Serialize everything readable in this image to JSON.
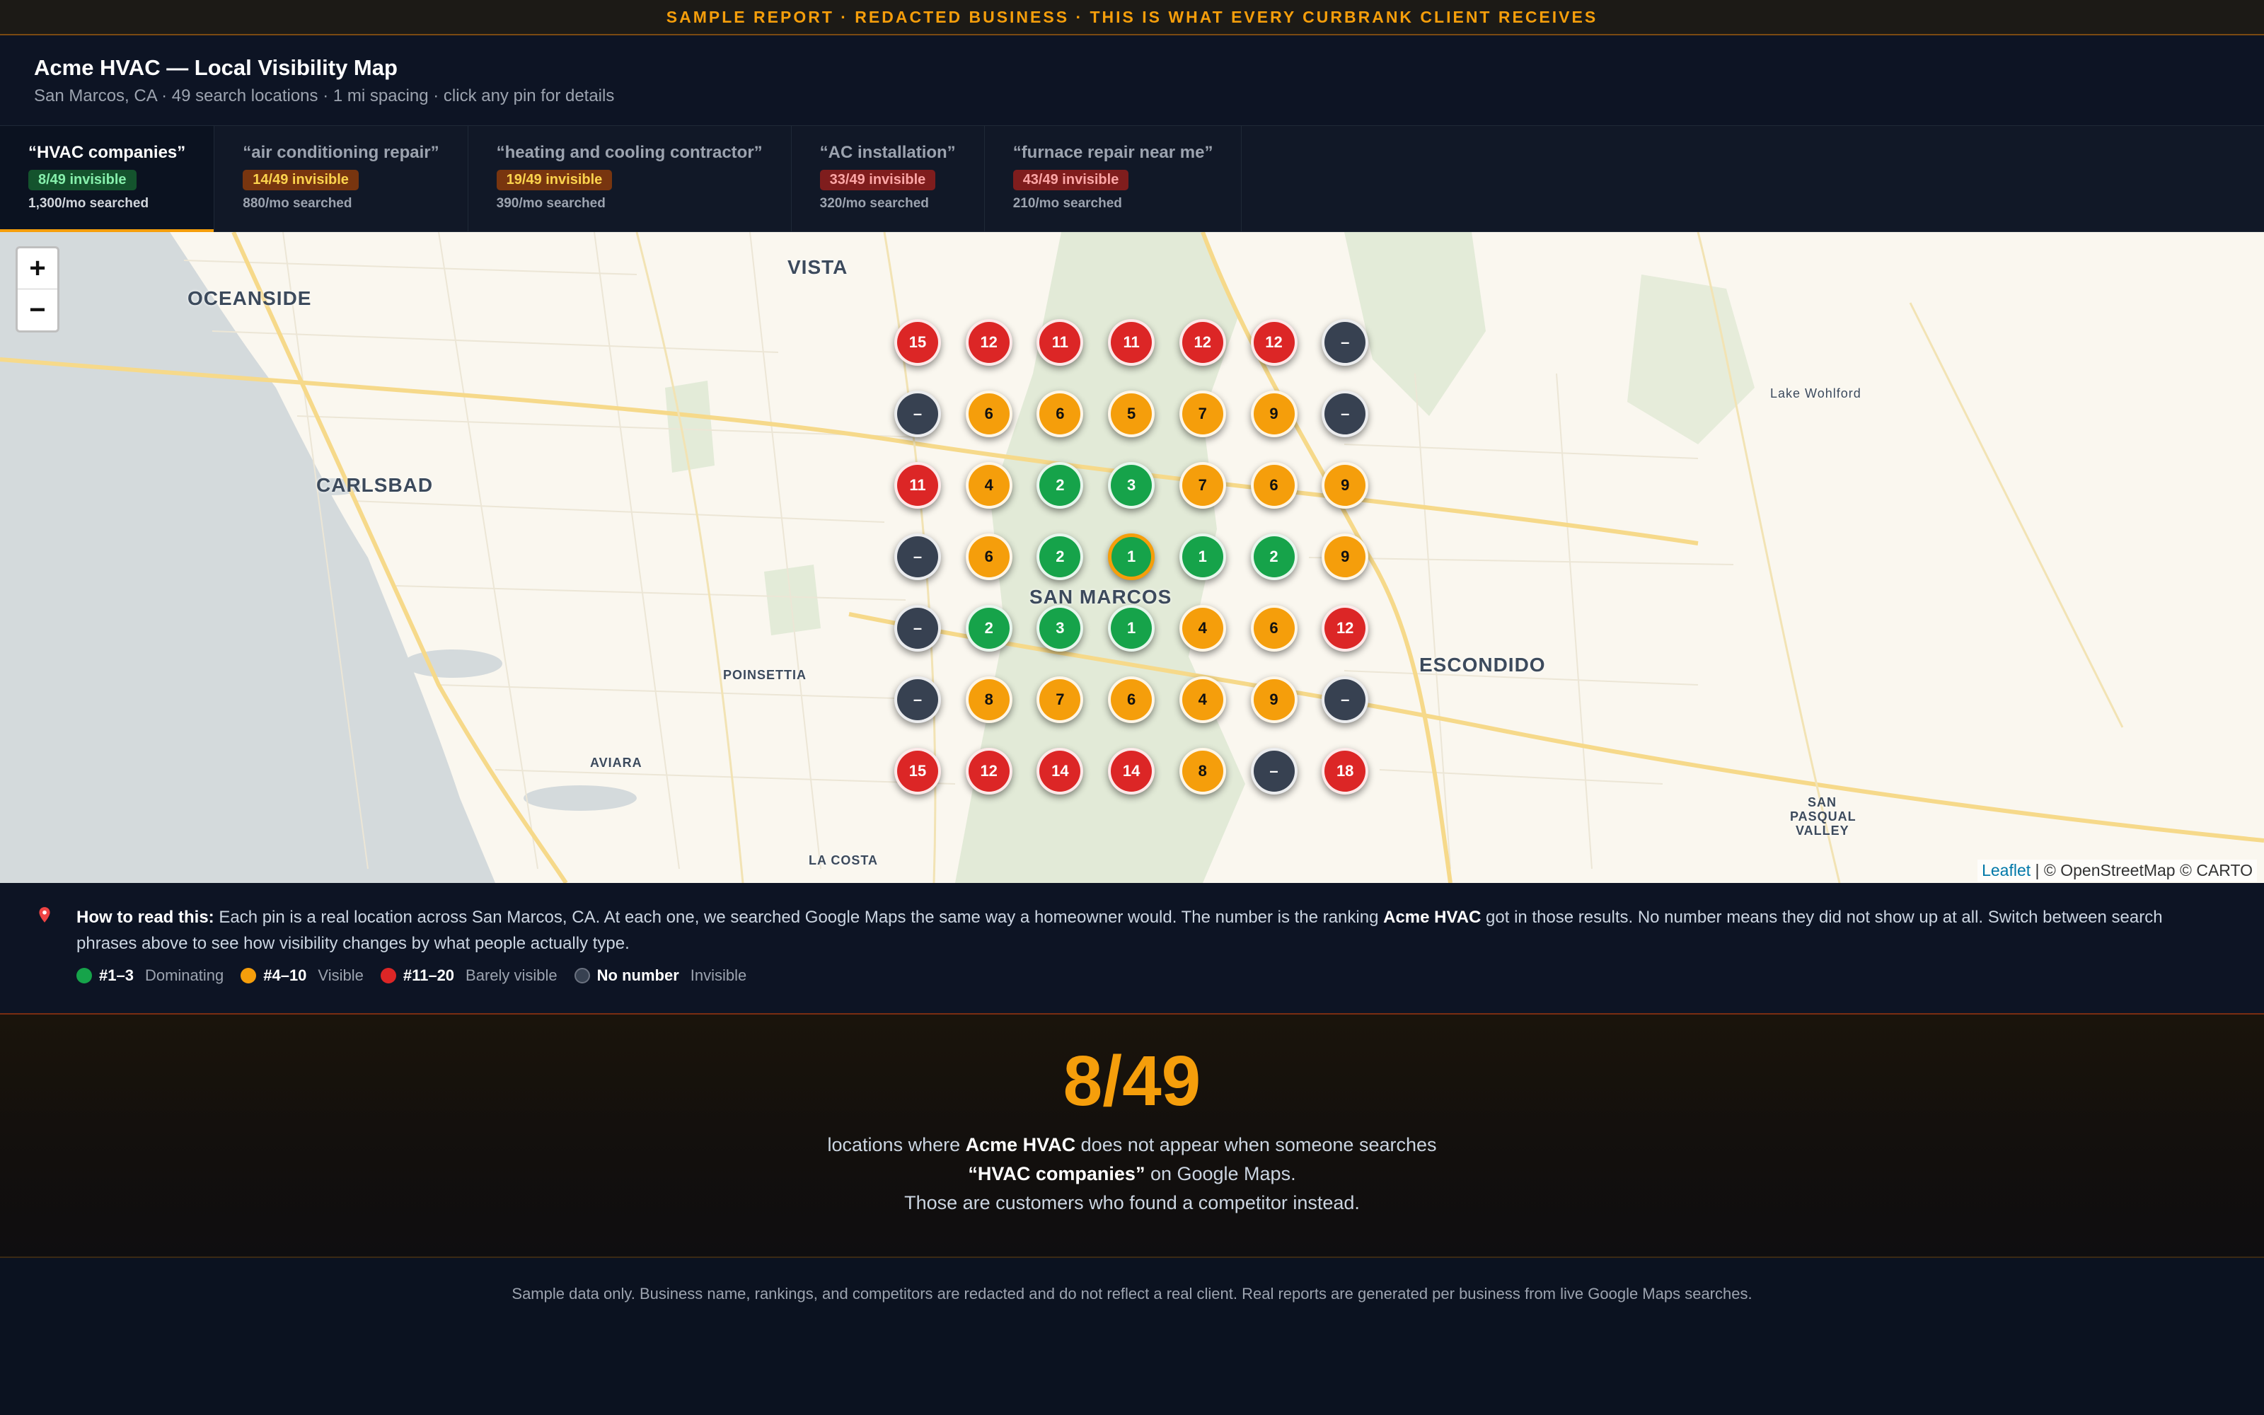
{
  "banner": "SAMPLE REPORT · REDACTED BUSINESS · THIS IS WHAT EVERY CURBRANK CLIENT RECEIVES",
  "header": {
    "title": "Acme HVAC — Local Visibility Map",
    "subtitle": "San Marcos, CA · 49 search locations · 1 mi spacing · click any pin for details"
  },
  "tabs": [
    {
      "title": "“HVAC companies”",
      "badge": "8/49 invisible",
      "badge_color": "green",
      "sub": "1,300/mo searched",
      "active": true
    },
    {
      "title": "“air conditioning repair”",
      "badge": "14/49 invisible",
      "badge_color": "amber",
      "sub": "880/mo searched",
      "active": false
    },
    {
      "title": "“heating and cooling contractor”",
      "badge": "19/49 invisible",
      "badge_color": "amber",
      "sub": "390/mo searched",
      "active": false
    },
    {
      "title": "“AC installation”",
      "badge": "33/49 invisible",
      "badge_color": "red",
      "sub": "320/mo searched",
      "active": false
    },
    {
      "title": "“furnace repair near me”",
      "badge": "43/49 invisible",
      "badge_color": "red",
      "sub": "210/mo searched",
      "active": false
    }
  ],
  "map": {
    "zoom_in": "+",
    "zoom_out": "−",
    "places": {
      "oceanside": "OCEANSIDE",
      "vista": "VISTA",
      "carlsbad": "CARLSBAD",
      "san_marcos": "SAN MARCOS",
      "escondido": "ESCONDIDO",
      "lake_wohlford": "Lake Wohlford",
      "poinsettia": "POINSETTIA",
      "aviara": "AVIARA",
      "la_costa": "LA COSTA",
      "san_pasqual_1": "SAN",
      "san_pasqual_2": "PASQUAL",
      "san_pasqual_3": "VALLEY"
    },
    "attribution_leaflet": "Leaflet",
    "attribution_rest": " | © OpenStreetMap © CARTO",
    "grid": [
      [
        "15",
        "12",
        "11",
        "11",
        "12",
        "12",
        "–"
      ],
      [
        "–",
        "6",
        "6",
        "5",
        "7",
        "9",
        "–"
      ],
      [
        "11",
        "4",
        "2",
        "3",
        "7",
        "6",
        "9"
      ],
      [
        "–",
        "6",
        "2",
        "1",
        "1",
        "2",
        "9"
      ],
      [
        "–",
        "2",
        "3",
        "1",
        "4",
        "6",
        "12"
      ],
      [
        "–",
        "8",
        "7",
        "6",
        "4",
        "9",
        "–"
      ],
      [
        "15",
        "12",
        "14",
        "14",
        "8",
        "–",
        "18"
      ]
    ],
    "colors": {
      "dominating": "#16a34a",
      "visible": "#f59e0b",
      "barely": "#dc2626",
      "invisible": "#374151"
    }
  },
  "legend": {
    "how_label": "How to read this:",
    "how_text_1": " Each pin is a real location across San Marcos, CA. At each one, we searched Google Maps the same way a homeowner would. The number is the ranking ",
    "business": "Acme HVAC",
    "how_text_2": " got in those results. No number means they did not show up at all. Switch between search phrases above to see how visibility changes by what people actually type.",
    "keys": [
      {
        "range": "#1–3",
        "label": "Dominating"
      },
      {
        "range": "#4–10",
        "label": "Visible"
      },
      {
        "range": "#11–20",
        "label": "Barely visible"
      },
      {
        "range": "No number",
        "label": "Invisible"
      }
    ]
  },
  "stat": {
    "value": "8/49",
    "line1_a": "locations where ",
    "line1_b": "Acme HVAC",
    "line1_c": " does not appear when someone searches",
    "line2_a": "“HVAC companies”",
    "line2_b": " on Google Maps.",
    "line3": "Those are customers who found a competitor instead."
  },
  "footer": "Sample data only. Business name, rankings, and competitors are redacted and do not reflect a real client. Real reports are generated per business from live Google Maps searches."
}
